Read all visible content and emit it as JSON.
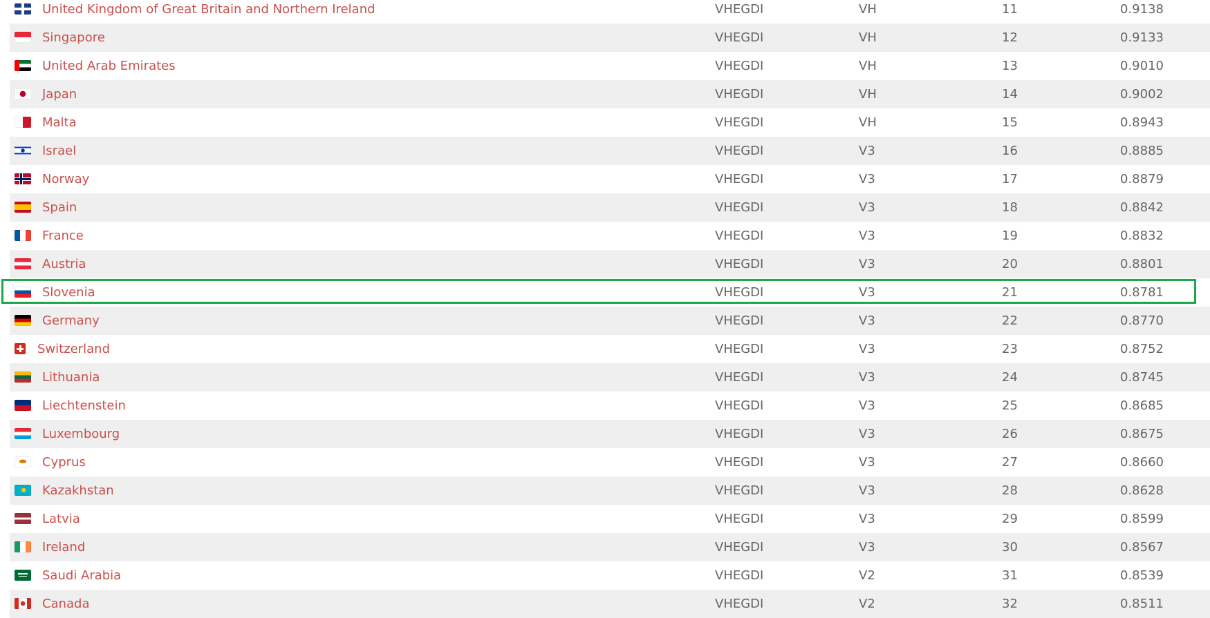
{
  "rows": [
    {
      "name": "United Kingdom of Great Britain and Northern Ireland",
      "group": "VHEGDI",
      "cat": "VH",
      "rank": "11",
      "value": "0.9138",
      "flag": "uk-flag-icon",
      "flag_bg": "linear-gradient(#ffffff 0 0) center/100% 4px no-repeat, linear-gradient(#ffffff 0 0) center/4px 100% no-repeat, linear-gradient(#cf142b 0 0) center/100% 2px no-repeat, linear-gradient(#cf142b 0 0) center/2px 100% no-repeat, #1f3a8a"
    },
    {
      "name": "Singapore",
      "group": "VHEGDI",
      "cat": "VH",
      "rank": "12",
      "value": "0.9133",
      "flag": "singapore-flag-icon",
      "flag_bg": "linear-gradient(#ee2536 50%, #ffffff 50%)"
    },
    {
      "name": "United Arab Emirates",
      "group": "VHEGDI",
      "cat": "VH",
      "rank": "13",
      "value": "0.9010",
      "flag": "uae-flag-icon",
      "flag_bg": "linear-gradient(90deg, #ff0000 30%, transparent 30%), linear-gradient(#00732f 33%, #ffffff 33% 66%, #000000 66%)"
    },
    {
      "name": "Japan",
      "group": "VHEGDI",
      "cat": "VH",
      "rank": "14",
      "value": "0.9002",
      "flag": "japan-flag-icon",
      "flag_bg": "radial-gradient(circle at 50% 50%, #bc002d 0 4px, #ffffff 4.5px)"
    },
    {
      "name": "Malta",
      "group": "VHEGDI",
      "cat": "VH",
      "rank": "15",
      "value": "0.8943",
      "flag": "malta-flag-icon",
      "flag_bg": "linear-gradient(90deg, #ffffff 50%, #cf142b 50%)"
    },
    {
      "name": "Israel",
      "group": "VHEGDI",
      "cat": "V3",
      "rank": "16",
      "value": "0.8885",
      "flag": "israel-flag-icon",
      "flag_bg": "radial-gradient(circle, #0038b8 0 2.5px, transparent 3px), linear-gradient(#ffffff 15%, #0038b8 15% 28%, #ffffff 28% 72%, #0038b8 72% 85%, #ffffff 85%)"
    },
    {
      "name": "Norway",
      "group": "VHEGDI",
      "cat": "V3",
      "rank": "17",
      "value": "0.8879",
      "flag": "norway-flag-icon",
      "flag_bg": "linear-gradient(#00205b 0 0) 8px 0/3px 100% no-repeat, linear-gradient(#00205b 0 0) 0 6.5px/100% 3px no-repeat, linear-gradient(#ffffff 0 0) 7px 0/5px 100% no-repeat, linear-gradient(#ffffff 0 0) 0 5.5px/100% 5px no-repeat, #ba0c2f"
    },
    {
      "name": "Spain",
      "group": "VHEGDI",
      "cat": "V3",
      "rank": "18",
      "value": "0.8842",
      "flag": "spain-flag-icon",
      "flag_bg": "linear-gradient(#c60b1e 25%, #ffc400 25% 75%, #c60b1e 75%)"
    },
    {
      "name": "France",
      "group": "VHEGDI",
      "cat": "V3",
      "rank": "19",
      "value": "0.8832",
      "flag": "france-flag-icon",
      "flag_bg": "linear-gradient(90deg, #0055a4 33%, #ffffff 33% 66%, #ef4135 66%)"
    },
    {
      "name": "Austria",
      "group": "VHEGDI",
      "cat": "V3",
      "rank": "20",
      "value": "0.8801",
      "flag": "austria-flag-icon",
      "flag_bg": "linear-gradient(#ed2939 33%, #ffffff 33% 66%, #ed2939 66%)"
    },
    {
      "name": "Slovenia",
      "group": "VHEGDI",
      "cat": "V3",
      "rank": "21",
      "value": "0.8781",
      "flag": "slovenia-flag-icon",
      "flag_bg": "linear-gradient(#ffffff 33%, #0055a4 33% 66%, #ed1c24 66%)"
    },
    {
      "name": "Germany",
      "group": "VHEGDI",
      "cat": "V3",
      "rank": "22",
      "value": "0.8770",
      "flag": "germany-flag-icon",
      "flag_bg": "linear-gradient(#000000 33%, #dd0000 33% 66%, #ffce00 66%)"
    },
    {
      "name": "Switzerland",
      "group": "VHEGDI",
      "cat": "V3",
      "rank": "23",
      "value": "0.8752",
      "flag": "switzerland-flag-icon",
      "flag_bg": "linear-gradient(#ffffff 0 0) center/10px 3px no-repeat, linear-gradient(#ffffff 0 0) center/3px 10px no-repeat, #d52b1e",
      "small": true
    },
    {
      "name": "Lithuania",
      "group": "VHEGDI",
      "cat": "V3",
      "rank": "24",
      "value": "0.8745",
      "flag": "lithuania-flag-icon",
      "flag_bg": "linear-gradient(#fdb913 33%, #006a44 33% 66%, #c1272d 66%)"
    },
    {
      "name": "Liechtenstein",
      "group": "VHEGDI",
      "cat": "V3",
      "rank": "25",
      "value": "0.8685",
      "flag": "liechtenstein-flag-icon",
      "flag_bg": "linear-gradient(#002b7f 50%, #ce1126 50%)"
    },
    {
      "name": "Luxembourg",
      "group": "VHEGDI",
      "cat": "V3",
      "rank": "26",
      "value": "0.8675",
      "flag": "luxembourg-flag-icon",
      "flag_bg": "linear-gradient(#ed2939 33%, #ffffff 33% 66%, #00a1de 66%)"
    },
    {
      "name": "Cyprus",
      "group": "VHEGDI",
      "cat": "V3",
      "rank": "27",
      "value": "0.8660",
      "flag": "cyprus-flag-icon",
      "flag_bg": "radial-gradient(ellipse 6px 3px at 50% 45%, #d57800 0 80%, transparent 90%), #ffffff"
    },
    {
      "name": "Kazakhstan",
      "group": "VHEGDI",
      "cat": "V3",
      "rank": "28",
      "value": "0.8628",
      "flag": "kazakhstan-flag-icon",
      "flag_bg": "radial-gradient(circle at 55% 50%, #fec50c 0 3px, transparent 3.5px), #00afca"
    },
    {
      "name": "Latvia",
      "group": "VHEGDI",
      "cat": "V3",
      "rank": "29",
      "value": "0.8599",
      "flag": "latvia-flag-icon",
      "flag_bg": "linear-gradient(#9e3039 40%, #ffffff 40% 60%, #9e3039 60%)"
    },
    {
      "name": "Ireland",
      "group": "VHEGDI",
      "cat": "V3",
      "rank": "30",
      "value": "0.8567",
      "flag": "ireland-flag-icon",
      "flag_bg": "linear-gradient(90deg, #169b62 33%, #ffffff 33% 66%, #ff883e 66%)"
    },
    {
      "name": "Saudi Arabia",
      "group": "VHEGDI",
      "cat": "V2",
      "rank": "31",
      "value": "0.8539",
      "flag": "saudi-arabia-flag-icon",
      "flag_bg": "linear-gradient(#ffffff 0 0) center 60%/12px 1px no-repeat, linear-gradient(#ffffff 0 0) center 35%/14px 2px no-repeat, #006c35"
    },
    {
      "name": "Canada",
      "group": "VHEGDI",
      "cat": "V2",
      "rank": "32",
      "value": "0.8511",
      "flag": "canada-flag-icon",
      "flag_bg": "radial-gradient(circle at 50% 50%, #d52b1e 0 3px, transparent 3.5px), linear-gradient(90deg, #d52b1e 25%, #ffffff 25% 75%, #d52b1e 75%)"
    }
  ],
  "highlighted_row": "Slovenia",
  "highlight_color": "#1aa84a",
  "link_color": "#c9504c",
  "text_color": "#666666"
}
